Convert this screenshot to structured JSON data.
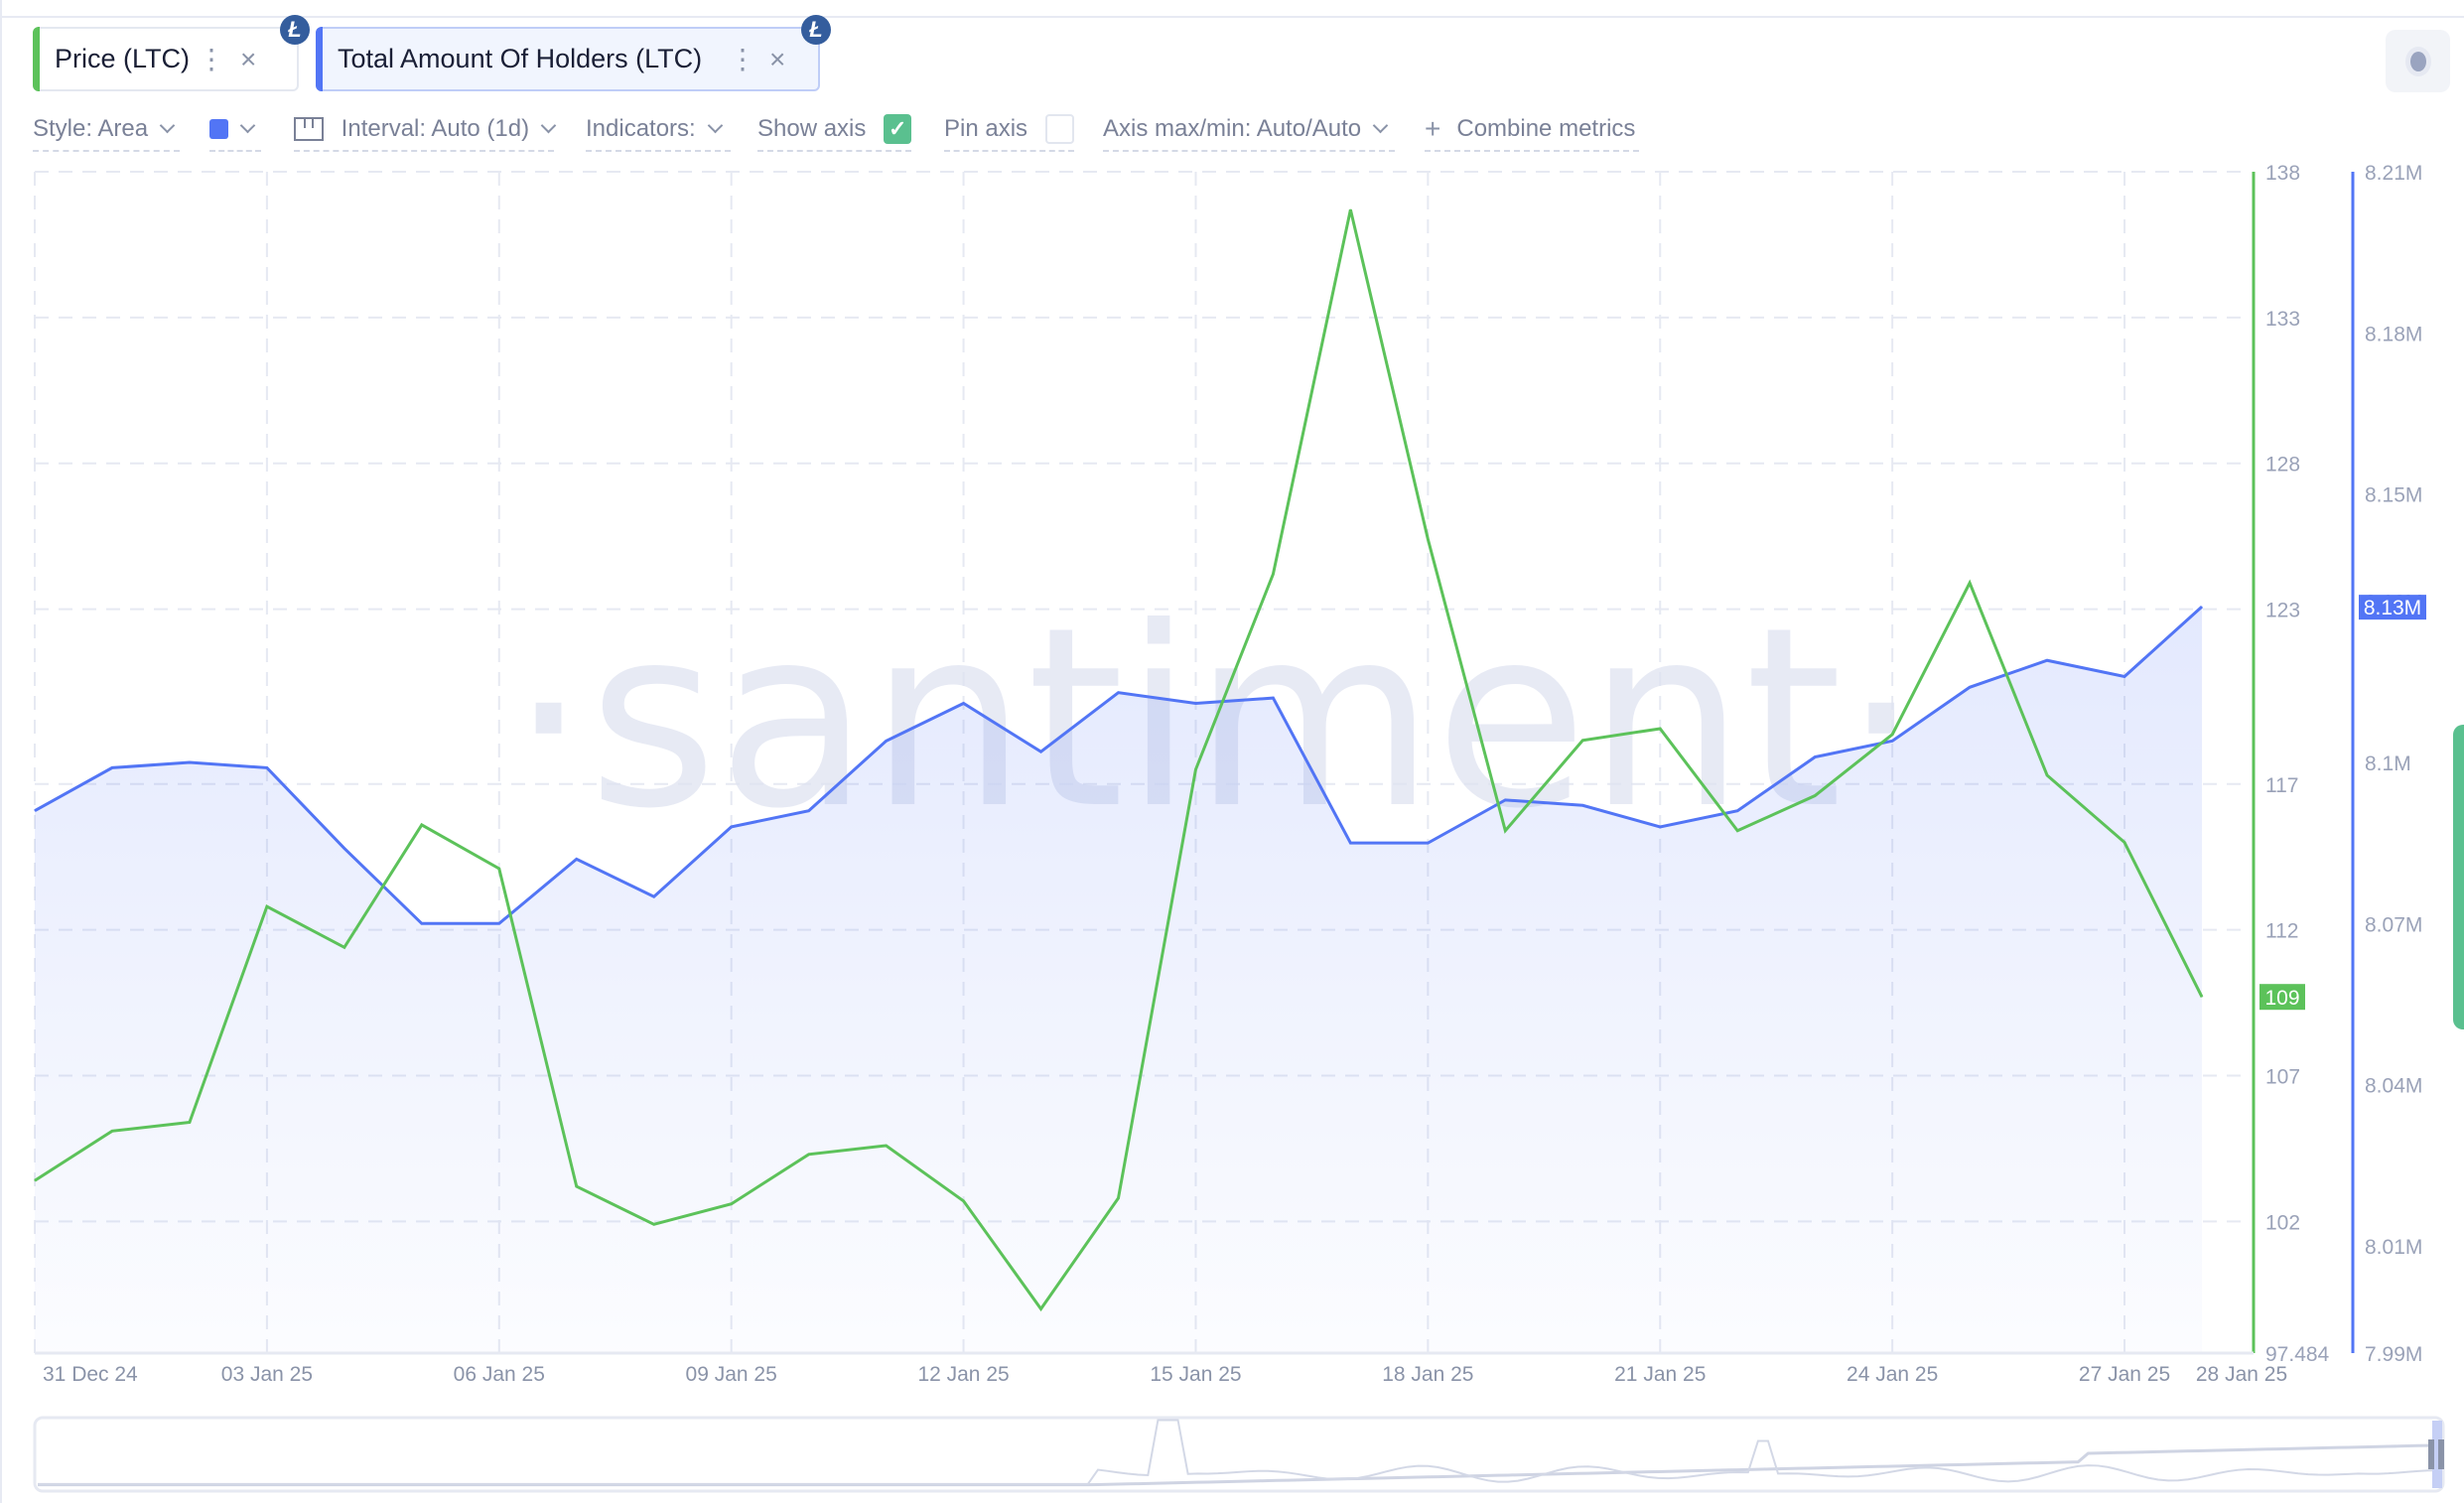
{
  "tabs": [
    {
      "label": "Price (LTC)",
      "color": "#5cc25a",
      "coin_icon": "litecoin-icon",
      "coin_glyph": "Ł"
    },
    {
      "label": "Total Amount Of Holders (LTC)",
      "color": "#5275f5",
      "coin_icon": "litecoin-icon",
      "coin_glyph": "Ł"
    }
  ],
  "icons": {
    "more": "⋮",
    "close": "×",
    "check": "✓",
    "plus": "+"
  },
  "toolbar": {
    "style": "Style: Area",
    "color_swatch": "#5275f5",
    "interval": "Interval: Auto (1d)",
    "indicators": "Indicators:",
    "show_axis": "Show axis",
    "show_axis_checked": true,
    "pin_axis": "Pin axis",
    "pin_axis_checked": false,
    "axis_maxmin": "Axis max/min: Auto/Auto",
    "combine": "Combine metrics"
  },
  "watermark": "·santiment·",
  "chart_data": {
    "type": "line",
    "title": "",
    "xlabel": "",
    "x": [
      "31 Dec 24",
      "01 Jan 25",
      "02 Jan 25",
      "03 Jan 25",
      "04 Jan 25",
      "05 Jan 25",
      "06 Jan 25",
      "07 Jan 25",
      "08 Jan 25",
      "09 Jan 25",
      "10 Jan 25",
      "11 Jan 25",
      "12 Jan 25",
      "13 Jan 25",
      "14 Jan 25",
      "15 Jan 25",
      "16 Jan 25",
      "17 Jan 25",
      "18 Jan 25",
      "19 Jan 25",
      "20 Jan 25",
      "21 Jan 25",
      "22 Jan 25",
      "23 Jan 25",
      "24 Jan 25",
      "25 Jan 25",
      "26 Jan 25",
      "27 Jan 25",
      "28 Jan 25"
    ],
    "x_tick_labels": [
      "31 Dec 24",
      "03 Jan 25",
      "06 Jan 25",
      "09 Jan 25",
      "12 Jan 25",
      "15 Jan 25",
      "18 Jan 25",
      "21 Jan 25",
      "24 Jan 25",
      "27 Jan 25",
      "28 Jan 25"
    ],
    "x_tick_indices": [
      0,
      3,
      6,
      9,
      12,
      15,
      18,
      21,
      24,
      27,
      28
    ],
    "grid": true,
    "series": [
      {
        "name": "Price (LTC)",
        "style": "line",
        "color": "#5cc25a",
        "axis": "price",
        "values": [
          103.4,
          105.1,
          105.4,
          112.8,
          111.4,
          115.6,
          114.1,
          103.2,
          101.9,
          102.6,
          104.3,
          104.6,
          102.7,
          99.0,
          102.8,
          117.5,
          124.2,
          136.7,
          125.4,
          115.4,
          118.5,
          118.9,
          115.4,
          116.6,
          118.7,
          123.9,
          117.3,
          115.0,
          109.7
        ],
        "last_value_label": "109"
      },
      {
        "name": "Total Amount Of Holders (LTC)",
        "style": "area",
        "color": "#5275f5",
        "axis": "holders",
        "values": [
          8.091,
          8.099,
          8.1,
          8.099,
          8.084,
          8.07,
          8.07,
          8.082,
          8.075,
          8.088,
          8.091,
          8.104,
          8.111,
          8.102,
          8.113,
          8.111,
          8.112,
          8.085,
          8.085,
          8.093,
          8.092,
          8.088,
          8.091,
          8.101,
          8.104,
          8.114,
          8.119,
          8.116,
          8.129
        ],
        "unit": "M",
        "last_value_label": "8.13M"
      }
    ],
    "axes": {
      "price": {
        "range": [
          97.484,
          138
        ],
        "ticks": [
          138,
          133,
          128,
          123,
          117,
          112,
          107,
          102
        ],
        "tick_labels": [
          "138",
          "133",
          "128",
          "123",
          "117",
          "112",
          "107",
          "102"
        ],
        "min_label": "97.484"
      },
      "holders": {
        "range": [
          7.99,
          8.21
        ],
        "ticks": [
          8.21,
          8.18,
          8.15,
          8.13,
          8.1,
          8.07,
          8.04,
          8.01
        ],
        "tick_labels": [
          "8.21M",
          "8.18M",
          "8.15M",
          "8.13M",
          "8.1M",
          "8.07M",
          "8.04M",
          "8.01M"
        ],
        "min_label": "7.99M"
      }
    }
  }
}
